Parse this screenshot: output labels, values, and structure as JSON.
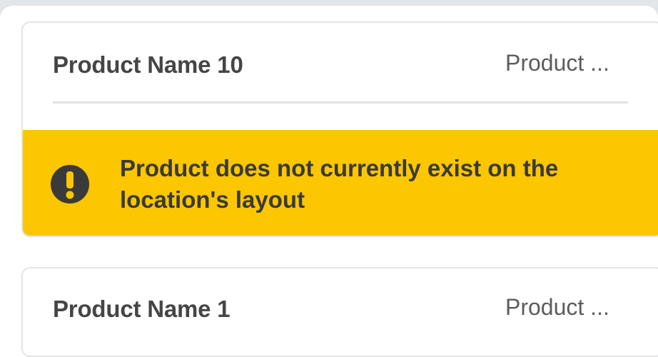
{
  "cards": [
    {
      "name": "Product Name 10",
      "meta": "Product ...",
      "warning": {
        "icon": "exclamation-circle-icon",
        "message": "Product does not currently exist on the location's layout",
        "color": "#fcc600"
      }
    },
    {
      "name": "Product Name 1",
      "meta": "Product ..."
    }
  ]
}
